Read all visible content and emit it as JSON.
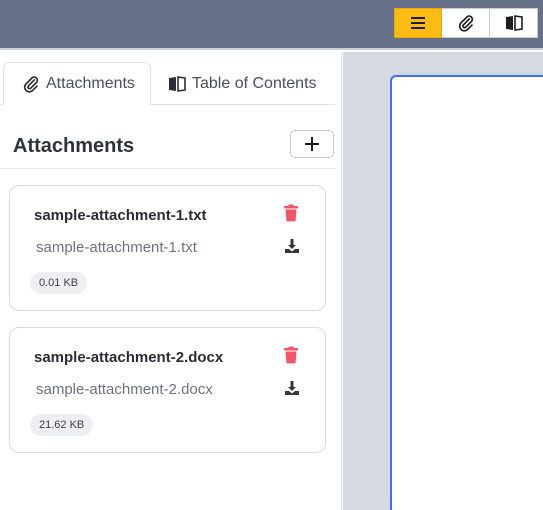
{
  "toolbar": {
    "buttons": [
      {
        "icon": "menu-icon",
        "active": true
      },
      {
        "icon": "paperclip-icon",
        "active": false
      },
      {
        "icon": "book-icon",
        "active": false
      }
    ],
    "accent": "#fdbb14",
    "bar_color": "#667089"
  },
  "sidebar": {
    "tabs": [
      {
        "label": "Attachments",
        "icon": "paperclip-icon",
        "active": true
      },
      {
        "label": "Table of Contents",
        "icon": "book-icon",
        "active": false
      }
    ],
    "section_title": "Attachments",
    "add_button_icon": "plus-icon",
    "attachments": [
      {
        "title": "sample-attachment-1.txt",
        "filename": "sample-attachment-1.txt",
        "size": "0.01 KB"
      },
      {
        "title": "sample-attachment-2.docx",
        "filename": "sample-attachment-2.docx",
        "size": "21.62 KB"
      }
    ],
    "delete_color": "#f2546a"
  },
  "viewer": {
    "page_border_color": "#3d6ff5"
  }
}
